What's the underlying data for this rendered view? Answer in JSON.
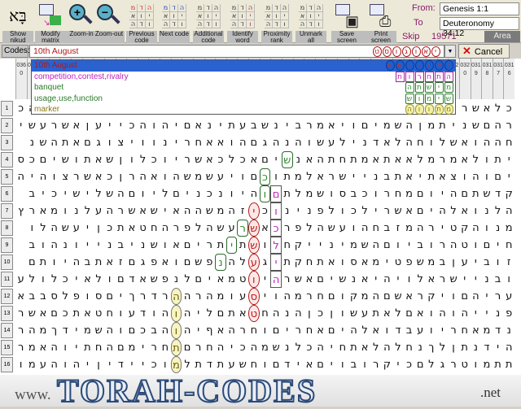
{
  "toolbar": {
    "buttons": [
      {
        "label": "Show nikud",
        "icon": "nikud-icon"
      },
      {
        "label": "Modify matrix",
        "icon": "modify-matrix-icon"
      },
      {
        "label": "Zoom-in",
        "icon": "zoom-in-icon"
      },
      {
        "label": "Zoom-out",
        "icon": "zoom-out-icon"
      },
      {
        "label": "Previous code",
        "icon": "previous-code-icon"
      },
      {
        "label": "Next code",
        "icon": "next-code-icon"
      },
      {
        "label": "Additional code",
        "icon": "additional-code-icon"
      },
      {
        "label": "Identify word",
        "icon": "identify-word-icon"
      },
      {
        "label": "Proximity rank",
        "icon": "proximity-rank-icon"
      },
      {
        "label": "Unmark all",
        "icon": "unmark-all-icon"
      },
      {
        "label": "Save screen",
        "icon": "save-screen-icon"
      },
      {
        "label": "Print screen",
        "icon": "print-screen-icon"
      }
    ],
    "nikud_glyph": "בָּא"
  },
  "range": {
    "from_label": "From:",
    "from": "Genesis 1:1",
    "to_label": "To",
    "to": "Deuteronomy 34:12",
    "skip_label": "Skip",
    "skip": "19571",
    "area": "Area"
  },
  "codes": {
    "label": "Codes:",
    "value": "10th August",
    "letters": "יאוגוסט",
    "cancel": "Cancel"
  },
  "dropdown": {
    "items": [
      {
        "label": "10th August",
        "color": "#b01818",
        "letters": "יאוגוסט",
        "style": "sel",
        "selected": true
      },
      {
        "label": "competition,contest,rivalry",
        "color": "#c020c0",
        "letters": "התחרות",
        "style": "purple"
      },
      {
        "label": "banquet",
        "color": "#2a7a2a",
        "letters": "מישתה",
        "style": "green"
      },
      {
        "label": "usage,use,function",
        "color": "#2a7a2a",
        "letters": "שימוש",
        "style": "green"
      },
      {
        "label": "marker",
        "color": "#8a7a10",
        "letters": "מתווה",
        "style": "yellow"
      }
    ]
  },
  "matrix": {
    "columns": [
      "0316",
      "0317",
      "0318",
      "0319",
      "0320",
      "0321",
      "0322",
      "0323",
      "0324",
      "0325",
      "0326",
      "0327",
      "0328",
      "0329",
      "0330",
      "0331",
      "0332",
      "0333",
      "0334",
      "0335",
      "0336",
      "0337",
      "0338",
      "0339",
      "0340",
      "0341",
      "0342",
      "0343",
      "0344",
      "0345",
      "0346",
      "0347",
      "0348",
      "0349",
      "0350",
      "0351",
      "0352",
      "0353",
      "0354",
      "0355",
      "0356",
      "0357",
      "0358",
      "0359",
      "0360"
    ],
    "rows": [
      {
        "n": "1",
        "text": "כלאשרו                                     הכ"
      },
      {
        "n": "2",
        "text": "רהםשניתמןהשמיםויאמרבינשבעתינאםיהוהכייעןאשרעשי"
      },
      {
        "n": "3",
        "text": "חההואשלוחהלאדנילעשוהנהגםהואאחרינוויצוגםאתהשנ"
      },
      {
        "n": "4",
        "text": "יתולאמרמלאאתאמתחתהאנשיםאכלכאשריוכלוןשאתושיםכס"
      },
      {
        "n": "5",
        "text": "יםוהוצאתיאתבניישראלמתוכםויעשמשהואהרןכאשרצוהיה"
      },
      {
        "n": "6",
        "text": "קדשתםהיוםמחרוכבסושמלתםוהיונכניםליוםהשלישיכיב"
      },
      {
        "n": "7",
        "text": "הלנואלהיםאשרילכולפנינוכיזהמשההאישאשרהעלנומארץ"
      },
      {
        "n": "8",
        "text": "מנוהקטירהמזבחהועשהלפרכאשרעשהלפרהחטאתכןיעשהלו"
      },
      {
        "n": "9",
        "text": "חיםוטהרוביוםהשמינייקחלושתיתריםאושניבנייונהוב"
      },
      {
        "n": "10",
        "text": "זוביעןבמשפטימאסואתחקתיגעלהנפשםואפגםזאתבהיותם"
      },
      {
        "n": "11",
        "text": "ובניישראלויהיאנשיםאשרהיוטמאיםלנפשאדםולאיכלולע"
      },
      {
        "n": "12",
        "text": "עריהםויקראשםהמקוםחרמהויסעומהרההרדרךיםסופלסבבא"
      },
      {
        "n": "13",
        "text": "פנייהוהואםלאתעשוןכןהנהחטאתםליהוהודעוחטאתכםאשר"
      },
      {
        "n": "14",
        "text": "נדמאחריועבדואלהיםאחריםוחרהאףיהוהבכםוהשמידךמהר"
      },
      {
        "n": "15",
        "text": "הידנתןלךנחלהלאתחיהכלנשמהכיהחרםתחרימםהחתיוהאמר"
      },
      {
        "n": "16",
        "text": "תתמוטרגלםכיקרובויםאידםוחשעתדתלמוכיידיןיהוהעמו"
      }
    ],
    "highlights": [
      {
        "row": 4,
        "col": 20,
        "style": "green"
      },
      {
        "row": 5,
        "col": 22,
        "style": "green"
      },
      {
        "row": 6,
        "col": 21,
        "style": "purple"
      },
      {
        "row": 6,
        "col": 22,
        "style": "green"
      },
      {
        "row": 7,
        "col": 21,
        "style": "purple"
      },
      {
        "row": 8,
        "col": 21,
        "style": "purple"
      },
      {
        "row": 9,
        "col": 21,
        "style": "purple"
      },
      {
        "row": 10,
        "col": 21,
        "style": "purple"
      },
      {
        "row": 11,
        "col": 21,
        "style": "purple"
      },
      {
        "row": 7,
        "col": 23,
        "style": "red"
      },
      {
        "row": 8,
        "col": 23,
        "style": "red"
      },
      {
        "row": 9,
        "col": 23,
        "style": "red"
      },
      {
        "row": 10,
        "col": 23,
        "style": "red"
      },
      {
        "row": 11,
        "col": 23,
        "style": "red"
      },
      {
        "row": 12,
        "col": 23,
        "style": "red"
      },
      {
        "row": 13,
        "col": 23,
        "style": "red"
      },
      {
        "row": 8,
        "col": 24,
        "style": "green"
      },
      {
        "row": 9,
        "col": 25,
        "style": "green"
      },
      {
        "row": 10,
        "col": 26,
        "style": "green"
      },
      {
        "row": 12,
        "col": 30,
        "style": "yellow"
      },
      {
        "row": 13,
        "col": 30,
        "style": "yellow"
      },
      {
        "row": 14,
        "col": 30,
        "style": "yellow"
      },
      {
        "row": 15,
        "col": 30,
        "style": "yellow"
      },
      {
        "row": 16,
        "col": 30,
        "style": "yellow"
      }
    ]
  },
  "banner": {
    "prefix": "www.",
    "logo": "TORAH-CODES",
    "suffix": ".net"
  },
  "colors": {
    "code_red": "#b01818",
    "purple": "#c020c0",
    "green": "#2a7a2a",
    "yellow": "#f4f0a8",
    "selection": "#2a62d0"
  }
}
